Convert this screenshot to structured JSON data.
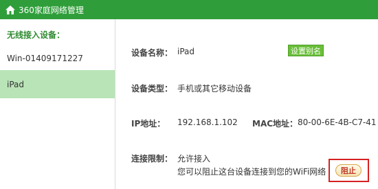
{
  "window": {
    "title": "360家庭网络管理",
    "icon": "home-icon"
  },
  "sidebar": {
    "header": "无线接入设备：",
    "items": [
      {
        "label": "Win-01409171227",
        "active": false
      },
      {
        "label": "iPad",
        "active": true
      }
    ]
  },
  "device": {
    "name_label": "设备名称：",
    "name": "iPad",
    "rename_button": "设置别名",
    "type_label": "设备类型：",
    "type": "手机或其它移动设备",
    "ip_label": "IP地址：",
    "ip": "192.168.1.102",
    "mac_label": "MAC地址：",
    "mac": "80-00-6E-4B-C7-41",
    "limit_label": "连接限制：",
    "limit_status": "允许接入",
    "limit_hint": "您可以阻止这台设备连接到您的WiFi网络",
    "block_button": "阻止"
  },
  "colors": {
    "titlebar": "#2f9e3a",
    "active_item": "#b9e4b7",
    "highlight": "#d62020"
  }
}
